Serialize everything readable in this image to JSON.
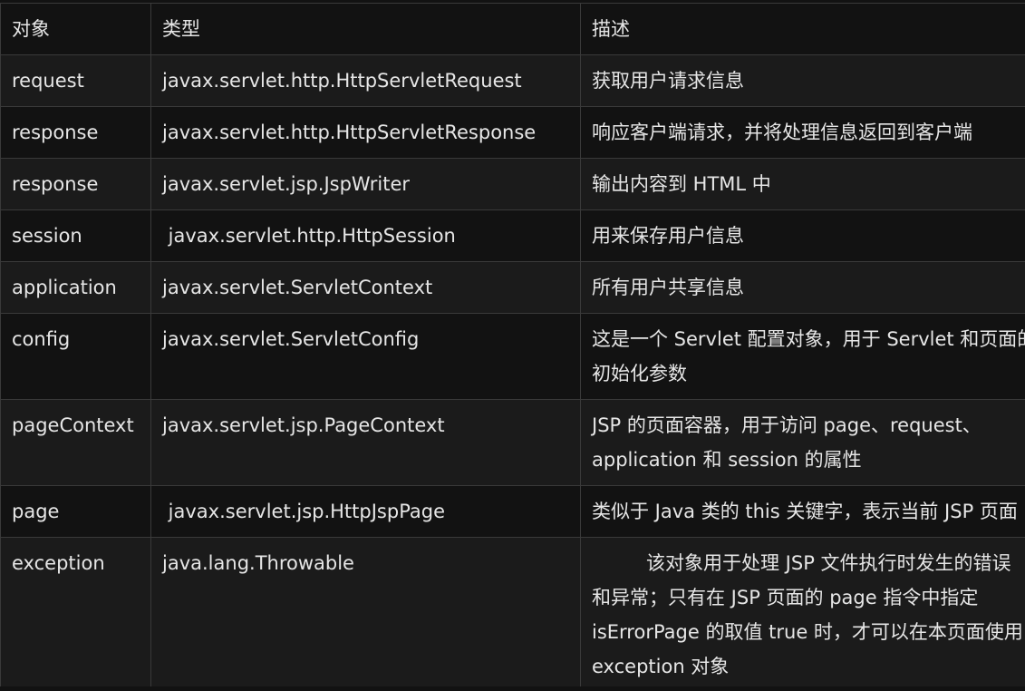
{
  "headers": [
    "对象",
    "类型",
    "描述"
  ],
  "rows": [
    {
      "object": "request",
      "type": "javax.servlet.http.HttpServletRequest",
      "desc": [
        "获取用户请求信息"
      ]
    },
    {
      "object": "response",
      "type": "javax.servlet.http.HttpServletResponse",
      "desc": [
        "响应客户端请求，并将处理信息返回到客户端"
      ]
    },
    {
      "object": "response",
      "type": "javax.servlet.jsp.JspWriter",
      "desc": [
        "输出内容到 HTML 中"
      ]
    },
    {
      "object": "session",
      "type": " javax.servlet.http.HttpSession",
      "desc": [
        "用来保存用户信息"
      ]
    },
    {
      "object": "application",
      "type": "javax.servlet.ServletContext",
      "desc": [
        "所有用户共享信息"
      ]
    },
    {
      "object": "config",
      "type": "javax.servlet.ServletConfig",
      "desc": [
        "这是一个 Servlet 配置对象，用于 Servlet 和页面的",
        "初始化参数"
      ]
    },
    {
      "object": "pageContext",
      "type": "javax.servlet.jsp.PageContext",
      "desc": [
        "JSP 的页面容器，用于访问 page、request、",
        "application 和 session 的属性"
      ]
    },
    {
      "object": "page",
      "type": " javax.servlet.jsp.HttpJspPage",
      "desc": [
        "类似于 Java 类的 this 关键字，表示当前 JSP 页面"
      ]
    },
    {
      "object": "exception",
      "type": "java.lang.Throwable",
      "desc": [
        "该对象用于处理 JSP 文件执行时发生的错误",
        "和异常；只有在 JSP 页面的 page 指令中指定",
        "isErrorPage 的取值 true 时，才可以在本页面使用",
        "exception 对象"
      ]
    }
  ]
}
